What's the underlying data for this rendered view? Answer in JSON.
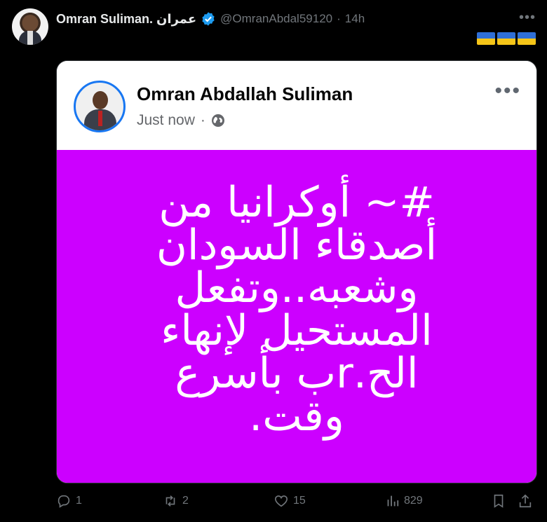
{
  "tweet": {
    "author_name": "Omran Suliman. عمران",
    "handle": "@OmranAbdal59120",
    "separator": "·",
    "time": "14h",
    "more": "•••"
  },
  "fb_post": {
    "author": "Omran Abdallah Suliman",
    "time": "Just now",
    "separator": "·",
    "more": "•••",
    "background_color": "#cc00ff",
    "text_lines": [
      "#~ أوكرانيا من",
      "أصدقاء السودان",
      "وشعبه..وتفعل",
      "المستحيل لإنهاء",
      "الح.rب بأسرع",
      "وقت."
    ]
  },
  "actions": {
    "replies": "1",
    "reposts": "2",
    "likes": "15",
    "views": "829"
  },
  "colors": {
    "accent": "#1d9bf0",
    "muted": "#71767b",
    "flag_blue": "#2f6fd6",
    "flag_yellow": "#f5c518"
  }
}
